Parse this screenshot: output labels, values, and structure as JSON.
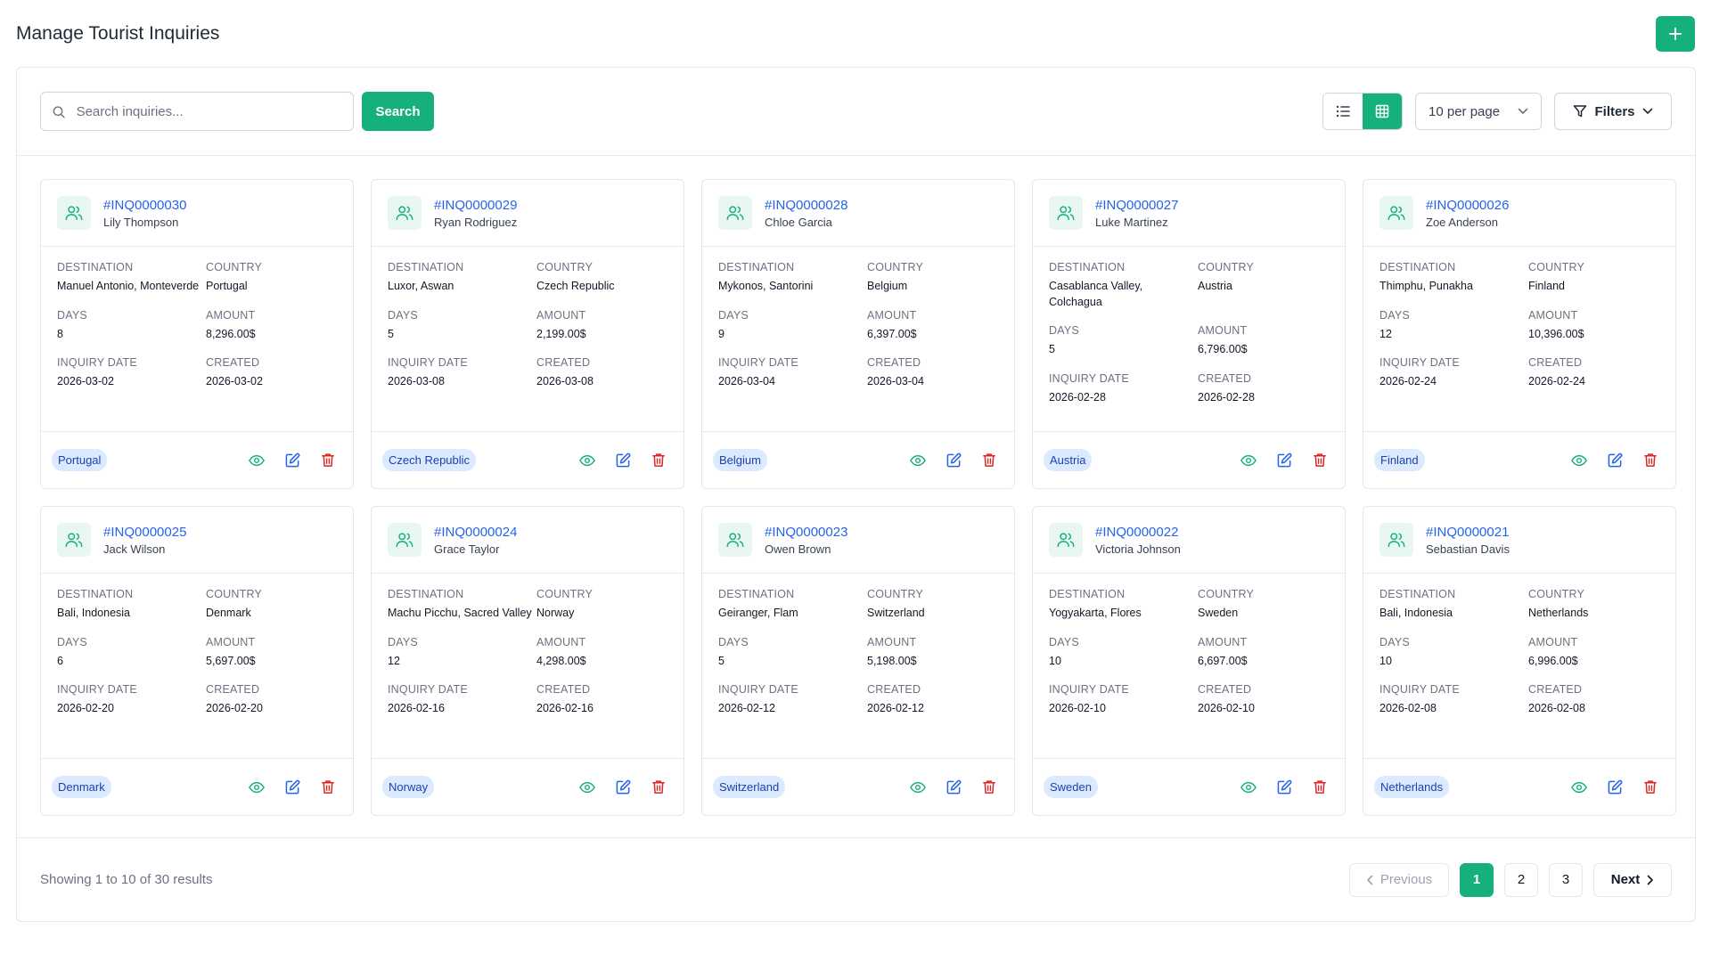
{
  "page": {
    "title": "Manage Tourist Inquiries"
  },
  "toolbar": {
    "search_placeholder": "Search inquiries...",
    "search_label": "Search",
    "per_page": "10 per page",
    "filters_label": "Filters"
  },
  "labels": {
    "destination": "DESTINATION",
    "country": "COUNTRY",
    "days": "DAYS",
    "amount": "AMOUNT",
    "inquiry_date": "INQUIRY DATE",
    "created": "CREATED"
  },
  "inquiries": [
    {
      "id": "#INQ0000030",
      "name": "Lily Thompson",
      "destination": "Manuel Antonio, Monteverde",
      "country": "Portugal",
      "days": "8",
      "amount": "8,296.00$",
      "inquiry_date": "2026-03-02",
      "created": "2026-03-02",
      "badge": "Portugal"
    },
    {
      "id": "#INQ0000029",
      "name": "Ryan Rodriguez",
      "destination": "Luxor, Aswan",
      "country": "Czech Republic",
      "days": "5",
      "amount": "2,199.00$",
      "inquiry_date": "2026-03-08",
      "created": "2026-03-08",
      "badge": "Czech Republic"
    },
    {
      "id": "#INQ0000028",
      "name": "Chloe Garcia",
      "destination": "Mykonos, Santorini",
      "country": "Belgium",
      "days": "9",
      "amount": "6,397.00$",
      "inquiry_date": "2026-03-04",
      "created": "2026-03-04",
      "badge": "Belgium"
    },
    {
      "id": "#INQ0000027",
      "name": "Luke Martinez",
      "destination": "Casablanca Valley, Colchagua",
      "country": "Austria",
      "days": "5",
      "amount": "6,796.00$",
      "inquiry_date": "2026-02-28",
      "created": "2026-02-28",
      "badge": "Austria"
    },
    {
      "id": "#INQ0000026",
      "name": "Zoe Anderson",
      "destination": "Thimphu, Punakha",
      "country": "Finland",
      "days": "12",
      "amount": "10,396.00$",
      "inquiry_date": "2026-02-24",
      "created": "2026-02-24",
      "badge": "Finland"
    },
    {
      "id": "#INQ0000025",
      "name": "Jack Wilson",
      "destination": "Bali, Indonesia",
      "country": "Denmark",
      "days": "6",
      "amount": "5,697.00$",
      "inquiry_date": "2026-02-20",
      "created": "2026-02-20",
      "badge": "Denmark"
    },
    {
      "id": "#INQ0000024",
      "name": "Grace Taylor",
      "destination": "Machu Picchu, Sacred Valley",
      "country": "Norway",
      "days": "12",
      "amount": "4,298.00$",
      "inquiry_date": "2026-02-16",
      "created": "2026-02-16",
      "badge": "Norway"
    },
    {
      "id": "#INQ0000023",
      "name": "Owen Brown",
      "destination": "Geiranger, Flam",
      "country": "Switzerland",
      "days": "5",
      "amount": "5,198.00$",
      "inquiry_date": "2026-02-12",
      "created": "2026-02-12",
      "badge": "Switzerland"
    },
    {
      "id": "#INQ0000022",
      "name": "Victoria Johnson",
      "destination": "Yogyakarta, Flores",
      "country": "Sweden",
      "days": "10",
      "amount": "6,697.00$",
      "inquiry_date": "2026-02-10",
      "created": "2026-02-10",
      "badge": "Sweden"
    },
    {
      "id": "#INQ0000021",
      "name": "Sebastian Davis",
      "destination": "Bali, Indonesia",
      "country": "Netherlands",
      "days": "10",
      "amount": "6,996.00$",
      "inquiry_date": "2026-02-08",
      "created": "2026-02-08",
      "badge": "Netherlands"
    }
  ],
  "pagination": {
    "summary": "Showing 1 to 10 of 30 results",
    "previous": "Previous",
    "next": "Next",
    "pages": [
      "1",
      "2",
      "3"
    ],
    "current": "1"
  },
  "colors": {
    "accent": "#16b07a",
    "link": "#2563eb",
    "danger": "#dc2626",
    "badge_bg": "#dbeafe"
  },
  "icons": [
    "plus-icon",
    "search-icon",
    "list-view-icon",
    "grid-view-icon",
    "chevron-down-icon",
    "filter-icon",
    "users-icon",
    "eye-icon",
    "edit-icon",
    "trash-icon",
    "chevron-left-icon",
    "chevron-right-icon"
  ]
}
